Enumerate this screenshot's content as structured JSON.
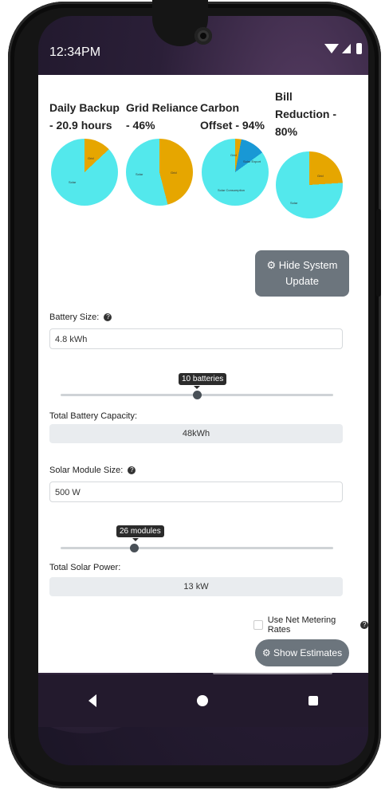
{
  "status": {
    "time": "12:34PM"
  },
  "charts": [
    {
      "title": "Daily Backup - 20.9 hours",
      "slices": [
        {
          "label": "Grid",
          "pct": 13,
          "color": "#e6a600"
        },
        {
          "label": "Solar",
          "pct": 87,
          "color": "#53e8ec"
        }
      ]
    },
    {
      "title": "Grid Reliance - 46%",
      "slices": [
        {
          "label": "Grid",
          "pct": 46,
          "color": "#e6a600"
        },
        {
          "label": "Solar",
          "pct": 54,
          "color": "#53e8ec"
        }
      ]
    },
    {
      "title": "Carbon Offset - 94%",
      "slices": [
        {
          "label": "Grid",
          "pct": 3,
          "color": "#e6a600"
        },
        {
          "label": "Solar Export",
          "pct": 12,
          "color": "#1998d5"
        },
        {
          "label": "Solar Consumption",
          "pct": 85,
          "color": "#53e8ec"
        }
      ]
    },
    {
      "title": "Bill Reduction - 80%",
      "slices": [
        {
          "label": "Grid",
          "pct": 24,
          "color": "#e6a600"
        },
        {
          "label": "Solar",
          "pct": 76,
          "color": "#53e8ec"
        }
      ]
    }
  ],
  "buttons": {
    "hide_update_icon": "⚙",
    "hide_update": "Hide System Update",
    "show_estimates_icon": "⚙",
    "show_estimates": "Show Estimates"
  },
  "battery": {
    "label": "Battery Size:",
    "value": "4.8 kWh",
    "slider_tooltip": "10 batteries",
    "slider_fraction": 0.5,
    "total_label": "Total Battery Capacity:",
    "total_value": "48kWh"
  },
  "solar": {
    "label": "Solar Module Size:",
    "value": "500 W",
    "slider_tooltip": "26 modules",
    "slider_fraction": 0.27,
    "total_label": "Total Solar Power:",
    "total_value": "13 kW"
  },
  "net_metering": {
    "label": "Use Net Metering Rates"
  },
  "help_glyph": "?"
}
